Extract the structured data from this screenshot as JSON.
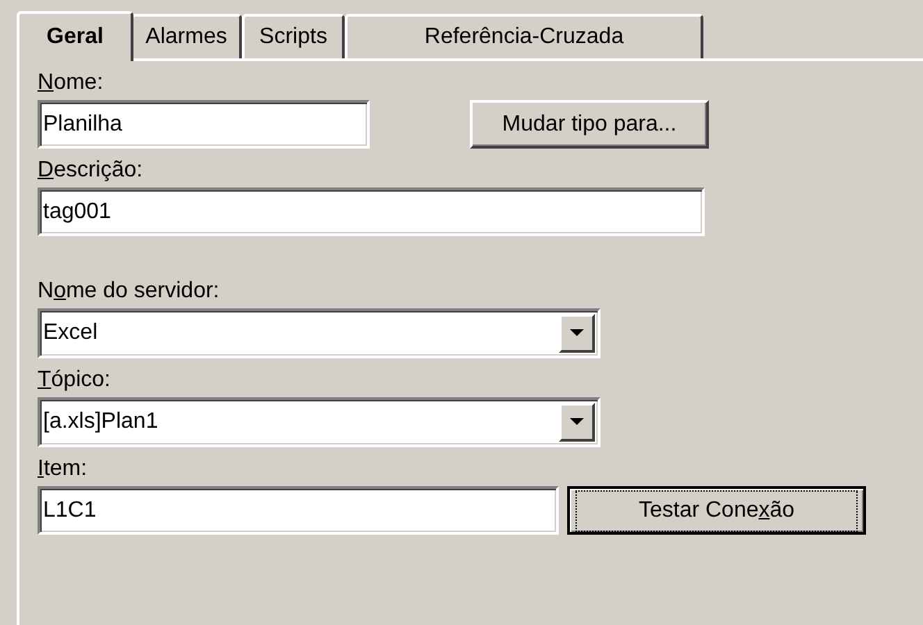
{
  "tabs": [
    {
      "label": "Geral",
      "selected": true
    },
    {
      "label": "Alarmes",
      "selected": false
    },
    {
      "label": "Scripts",
      "selected": false
    },
    {
      "label": "Referência-Cruzada",
      "selected": false
    }
  ],
  "fields": [
    {
      "kind": "text",
      "label_key": "N",
      "label_after": "ome:",
      "value": "Planilha",
      "button": {
        "label_before": "Mudar tipo para...",
        "default": false
      }
    },
    {
      "kind": "text",
      "label_key": "D",
      "label_after": "escrição:",
      "value": "tag001"
    },
    {
      "kind": "combo",
      "label_before": "N",
      "label_key": "o",
      "label_after": "me do servidor:",
      "value": "Excel"
    },
    {
      "kind": "combo",
      "label_key": "T",
      "label_after": "ópico:",
      "value": "[a.xls]Plan1"
    },
    {
      "kind": "text",
      "label_key": "I",
      "label_after": "tem:",
      "value": "L1C1",
      "button": {
        "label_before": "Testar Cone",
        "label_key": "x",
        "label_after": "ão",
        "default": true
      }
    }
  ]
}
